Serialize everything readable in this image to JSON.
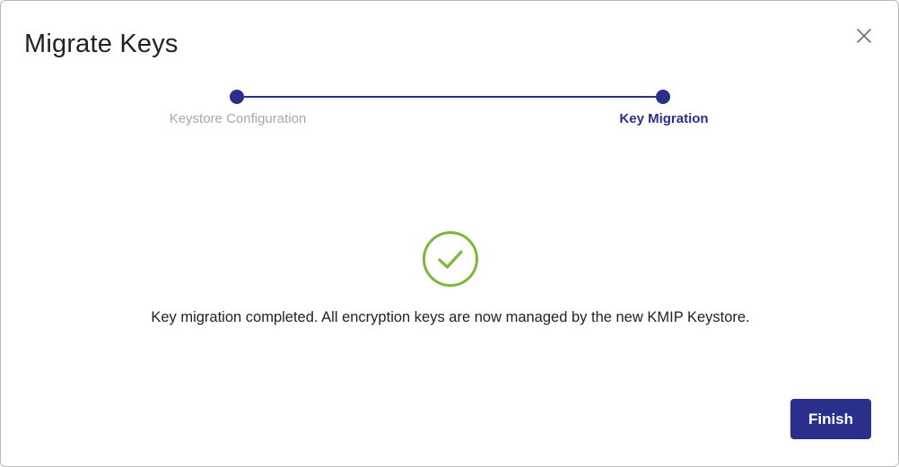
{
  "dialog": {
    "title": "Migrate Keys",
    "close_icon": "close-icon"
  },
  "stepper": {
    "steps": [
      {
        "label": "Keystore Configuration",
        "state": "completed"
      },
      {
        "label": "Key Migration",
        "state": "active"
      }
    ],
    "accent_color": "#2b2f8c",
    "inactive_label_color": "#a8a8ab"
  },
  "result": {
    "icon": "check-circle-icon",
    "icon_color": "#7cb83a",
    "message": "Key migration completed. All encryption keys are now managed by the new KMIP Keystore."
  },
  "footer": {
    "finish_label": "Finish",
    "button_color": "#2b2f8c"
  }
}
